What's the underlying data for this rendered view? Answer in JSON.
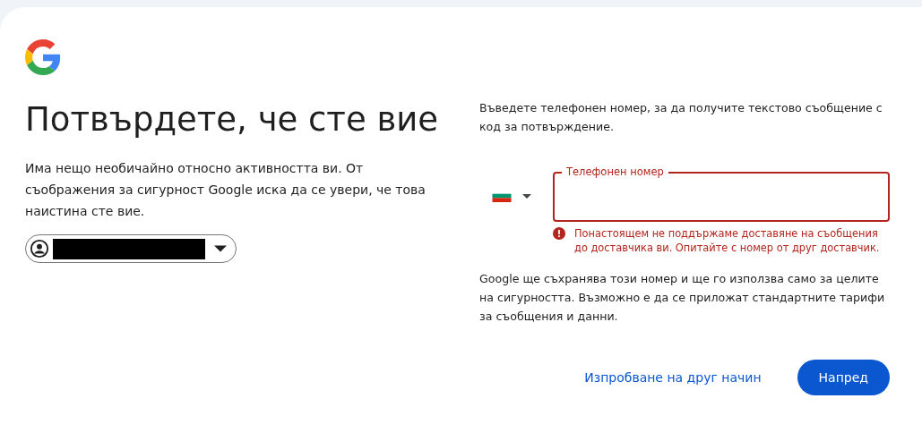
{
  "heading": "Потвърдете, че сте вие",
  "description": "Има нещо необичайно относно активността ви. От съображения за сигурност Google иска да се увери, че това наистина сте вие.",
  "account_chip": {
    "redacted": true
  },
  "phone_prompt": "Въведете телефонен номер, за да получите текстово съобщение с код за потвърждение.",
  "phone_field": {
    "label": "Телефонен номер",
    "invalid": true,
    "error": "Понастоящем не поддържаме доставяне на съобщения до доставчика ви. Опитайте с номер от друг доставчик."
  },
  "privacy_note": "Google ще съхранява този номер и ще го използва само за целите на сигурността. Възможно е да се приложат стандартните тарифи за съобщения и данни.",
  "buttons": [
    {
      "label": "Изпробване на друг начин",
      "kind": "text"
    },
    {
      "label": "Напред",
      "kind": "filled"
    }
  ]
}
